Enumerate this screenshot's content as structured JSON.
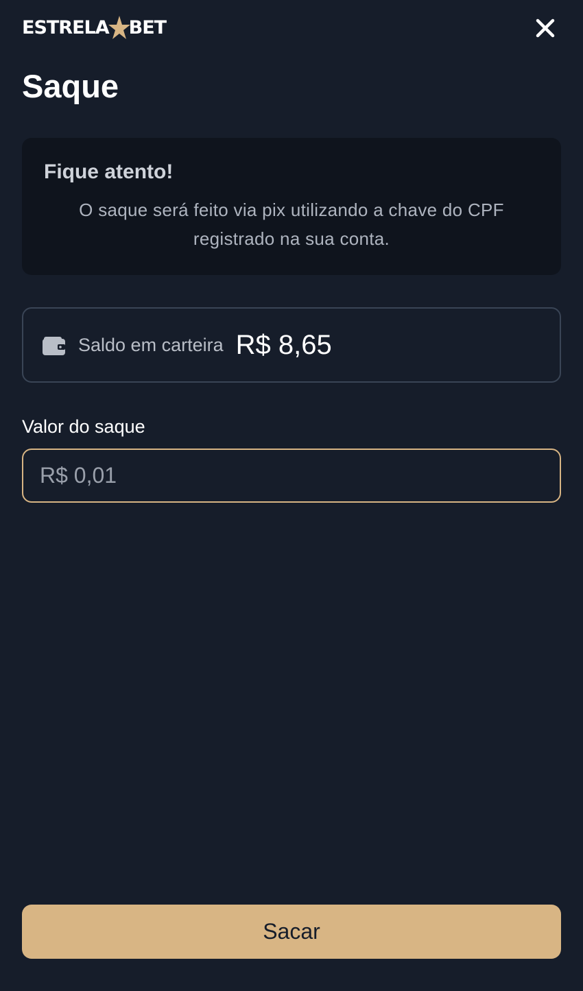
{
  "header": {
    "logo_left": "ESTRELA",
    "logo_right": "BET",
    "close_icon": "close-icon",
    "accent_color": "#d8b584"
  },
  "page": {
    "title": "Saque"
  },
  "notice": {
    "title": "Fique atento!",
    "text": "O saque será feito via pix utilizando a chave do CPF registrado na sua conta."
  },
  "balance": {
    "icon": "wallet-icon",
    "label": "Saldo em carteira",
    "value": "R$ 8,65"
  },
  "withdraw": {
    "label": "Valor do saque",
    "placeholder": "R$ 0,01",
    "value": ""
  },
  "actions": {
    "submit_label": "Sacar"
  }
}
